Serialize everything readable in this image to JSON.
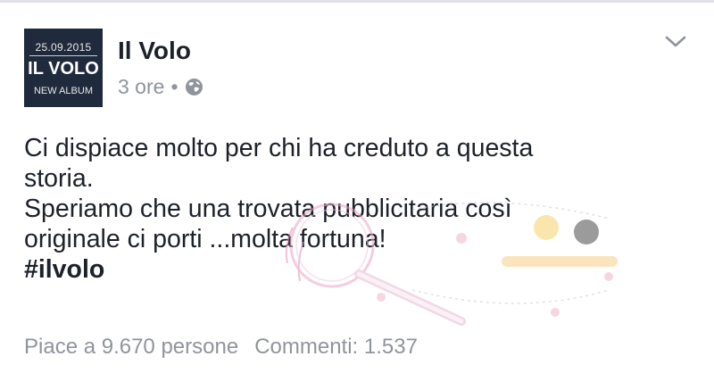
{
  "post": {
    "avatar": {
      "date": "25.09.2015",
      "band": "IL VOLO",
      "album": "NEW ALBUM"
    },
    "page_name": "Il Volo",
    "time": "3 ore",
    "dot": "•",
    "privacy_icon": "globe-icon",
    "menu_icon": "chevron-down-icon",
    "text_lines": [
      "Ci dispiace molto per chi ha creduto a questa",
      "storia.",
      "Speriamo che una trovata pubblicitaria così",
      "originale ci porti ...molta fortuna!"
    ],
    "hashtag": "#ilvolo",
    "likes": "Piace a 9.670 persone",
    "comments": "Commenti: 1.537"
  },
  "colors": {
    "text_primary": "#1d2129",
    "text_secondary": "#90949c",
    "avatar_bg": "#1f2a3d"
  }
}
